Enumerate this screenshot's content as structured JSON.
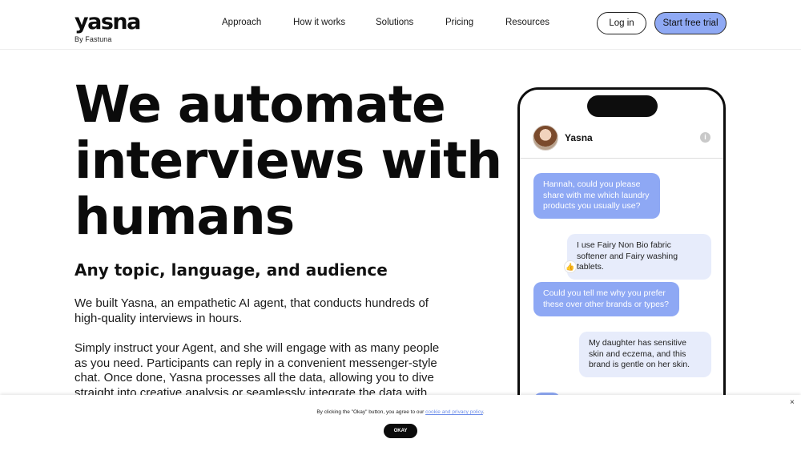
{
  "brand": {
    "logo": "yasna",
    "tagline": "By Fastuna"
  },
  "nav": {
    "items": [
      "Approach",
      "How it works",
      "Solutions",
      "Pricing",
      "Resources"
    ],
    "login": "Log in",
    "trial": "Start free trial"
  },
  "hero": {
    "title_lines": [
      "We automate",
      "interviews with",
      "humans"
    ],
    "subtitle": "Any topic, language, and audience",
    "paragraph1": "We built Yasna, an empathetic AI agent, that conducts hundreds of high-quality interviews in hours.",
    "paragraph2": "Simply instruct your Agent, and she will engage with as many people as you need. Participants can reply in a convenient messenger-style chat. Once done, Yasna processes all the data, allowing you to dive straight into creative analysis or seamlessly integrate the data with"
  },
  "phone": {
    "contact_name": "Yasna",
    "info_icon": "i",
    "messages": [
      "Hannah, could you please share with me which laundry products you usually use?",
      "I use Fairy Non Bio fabric softener and Fairy washing tablets.",
      "Could you tell me why you prefer these over other brands or types?",
      "My daughter has sensitive skin and eczema, and this brand is gentle on her skin."
    ],
    "reaction": "👍"
  },
  "cookie": {
    "text": "By clicking the \"Okay\" button, you agree to our",
    "link": "cookie and privacy policy",
    "period": ".",
    "ok": "OKAY",
    "close": "×"
  },
  "colors": {
    "accent": "#8fa9f4",
    "bubble_in": "#e7ecfb",
    "text": "#111111"
  }
}
